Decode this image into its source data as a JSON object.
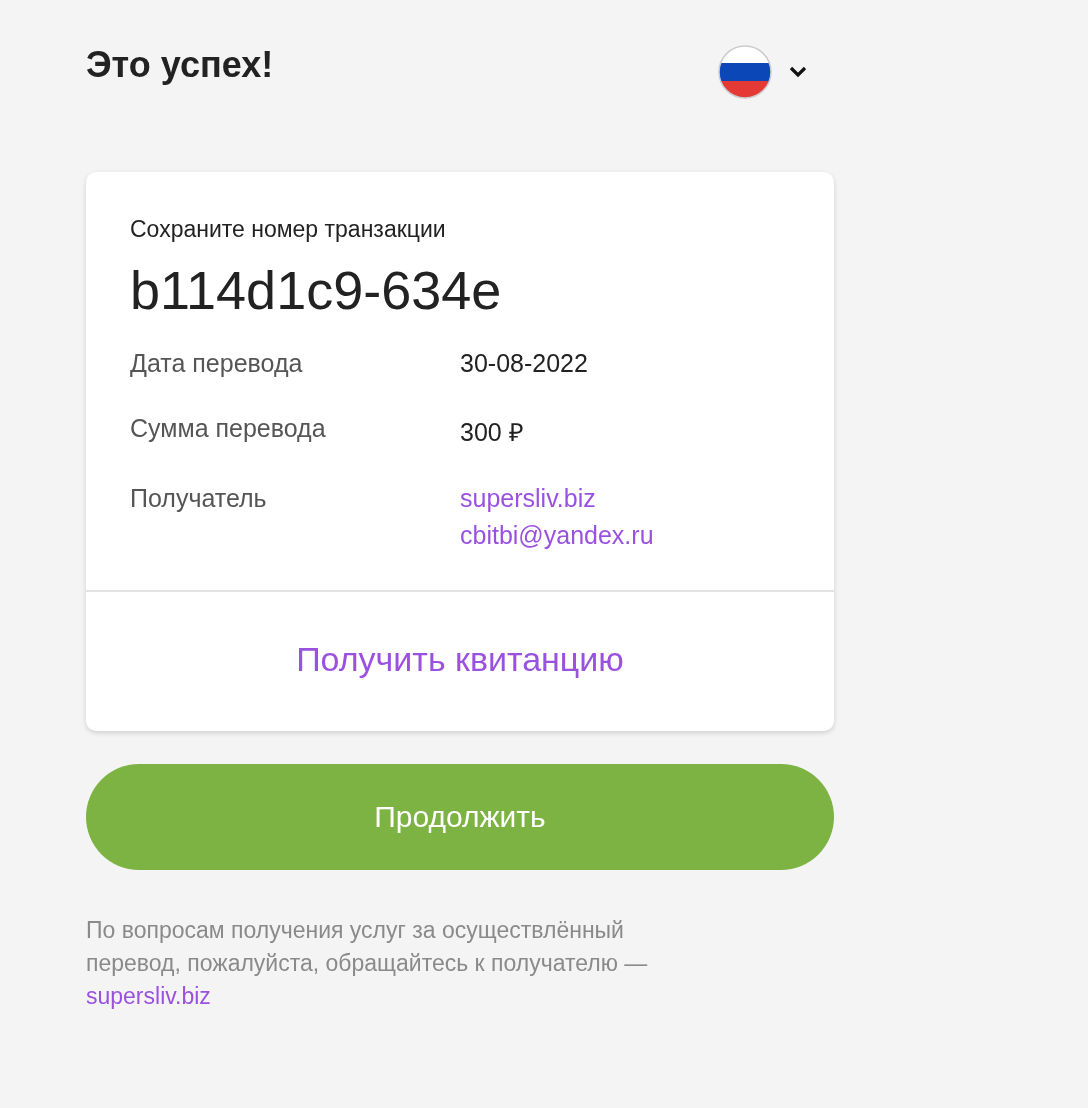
{
  "header": {
    "title": "Это успех!"
  },
  "card": {
    "caption": "Сохраните номер транзакции",
    "transaction_id": "b114d1c9-634e",
    "details": [
      {
        "label": "Дата перевода",
        "values": [
          {
            "kind": "text",
            "text": "30-08-2022"
          }
        ]
      },
      {
        "label": "Сумма перевода",
        "values": [
          {
            "kind": "text",
            "text": "300 ₽"
          }
        ]
      },
      {
        "label": "Получатель",
        "values": [
          {
            "kind": "link",
            "text": "supersliv.biz"
          },
          {
            "kind": "link",
            "text": "cbitbi@yandex.ru"
          }
        ]
      }
    ],
    "receipt_link": "Получить квитанцию"
  },
  "continue_button": "Продолжить",
  "footer": {
    "text": "По вопросам получения услуг за осуществлённый перевод, пожалуйста, обращайтесь к получателю —",
    "link": "supersliv.biz"
  }
}
